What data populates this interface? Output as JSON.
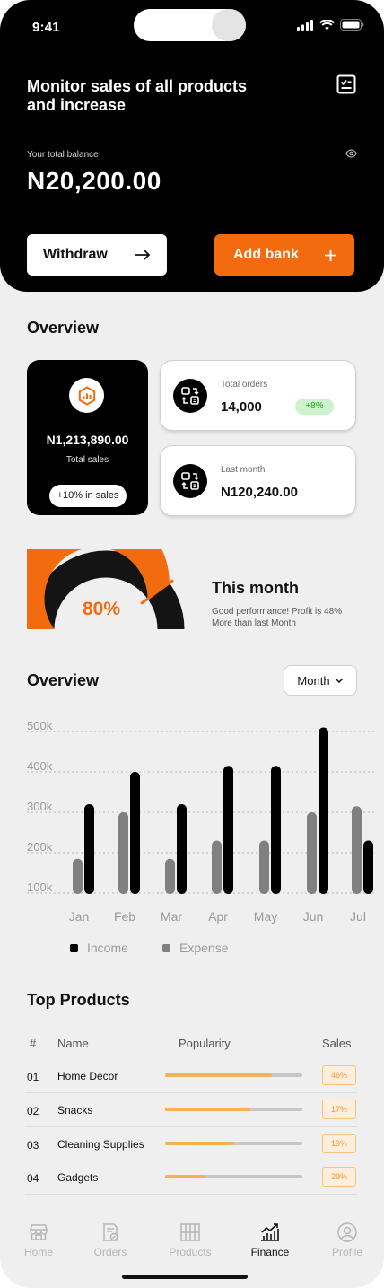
{
  "status_bar": {
    "time": "9:41"
  },
  "header": {
    "headline": "Monitor sales of all products and increase",
    "balance_label": "Your total balance",
    "balance": "N20,200.00",
    "withdraw_label": "Withdraw",
    "add_bank_label": "Add bank"
  },
  "overview": {
    "title": "Overview",
    "sales_card": {
      "amount": "N1,213,890.00",
      "caption": "Total sales",
      "pill": "+10% in sales"
    },
    "total_orders": {
      "label": "Total orders",
      "value": "14,000",
      "badge": "+8%"
    },
    "last_month": {
      "label": "Last month",
      "value": "N120,240.00"
    }
  },
  "this_month": {
    "percent_label": "80%",
    "percent_value": 80,
    "title": "This month",
    "description": "Good performance! Profit is 48% More than last Month"
  },
  "overview_chart_section": {
    "title": "Overview",
    "period_select": "Month"
  },
  "chart_data": {
    "type": "bar",
    "categories": [
      "Jan",
      "Feb",
      "Mar",
      "Apr",
      "May",
      "Jun",
      "Jul"
    ],
    "series": [
      {
        "name": "Income",
        "color": "#000000",
        "values": [
          320,
          400,
          320,
          415,
          415,
          510,
          230
        ]
      },
      {
        "name": "Expense",
        "color": "#808080",
        "values": [
          185,
          300,
          185,
          230,
          230,
          300,
          315
        ]
      }
    ],
    "yticks": [
      "500k",
      "400k",
      "300k",
      "200k",
      "100k"
    ],
    "ylim": [
      100,
      500
    ],
    "grid": true,
    "legend_position": "bottom-left"
  },
  "top_products": {
    "title": "Top Products",
    "headers": {
      "index": "#",
      "name": "Name",
      "popularity": "Popularity",
      "sales": "Sales"
    },
    "rows": [
      {
        "index": "01",
        "name": "Home Decor",
        "popularity": 0.78,
        "sales": "46%"
      },
      {
        "index": "02",
        "name": "Snacks",
        "popularity": 0.62,
        "sales": "17%"
      },
      {
        "index": "03",
        "name": "Cleaning Supplies",
        "popularity": 0.5,
        "sales": "19%"
      },
      {
        "index": "04",
        "name": "Gadgets",
        "popularity": 0.3,
        "sales": "29%"
      }
    ]
  },
  "nav": {
    "items": [
      {
        "label": "Home",
        "icon": "store-icon",
        "active": false
      },
      {
        "label": "Orders",
        "icon": "clipboard-check-icon",
        "active": false
      },
      {
        "label": "Products",
        "icon": "boxes-icon",
        "active": false
      },
      {
        "label": "Finance",
        "icon": "chart-growth-icon",
        "active": true
      },
      {
        "label": "Profile",
        "icon": "user-circle-icon",
        "active": false
      }
    ]
  },
  "colors": {
    "accent": "#f26b0f",
    "dark": "#000000",
    "success": "#1aa61a",
    "popularity": "#f7b24f"
  }
}
